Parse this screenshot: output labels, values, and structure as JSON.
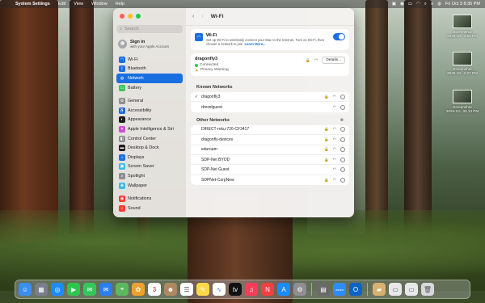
{
  "menubar": {
    "apple": "",
    "items": [
      "System Settings",
      "Edit",
      "View",
      "Window",
      "Help"
    ],
    "clock": "Fri Oct 3  8:35 PM"
  },
  "desktop_files": [
    {
      "name": "Screenshot",
      "detail": "2025-10...1.53 PM"
    },
    {
      "name": "Screenshot",
      "detail": "2025-10...2.27 PM"
    },
    {
      "name": "Screenshot",
      "detail": "2025-10...33.13 PM"
    }
  ],
  "sidebar": {
    "search_placeholder": "Search",
    "signin_title": "Sign in",
    "signin_subtitle": "with your Apple Account",
    "group1": [
      {
        "label": "Wi-Fi",
        "color": "#1a6fe0",
        "glyph": "◠"
      },
      {
        "label": "Bluetooth",
        "color": "#1a6fe0",
        "glyph": "ᛒ"
      },
      {
        "label": "Network",
        "color": "#1a6fe0",
        "glyph": "◍",
        "selected": true
      },
      {
        "label": "Battery",
        "color": "#34c759",
        "glyph": "▭"
      }
    ],
    "group2": [
      {
        "label": "General",
        "color": "#8e8e93",
        "glyph": "⚙"
      },
      {
        "label": "Accessibility",
        "color": "#1a6fe0",
        "glyph": "♿"
      },
      {
        "label": "Appearance",
        "color": "#1d1d1f",
        "glyph": "◐"
      },
      {
        "label": "Apple Intelligence & Siri",
        "color": "#d04ad6",
        "glyph": "✦"
      },
      {
        "label": "Control Center",
        "color": "#8e8e93",
        "glyph": "◧"
      },
      {
        "label": "Desktop & Dock",
        "color": "#1d1d1f",
        "glyph": "▬"
      },
      {
        "label": "Displays",
        "color": "#1a6fe0",
        "glyph": "☼"
      },
      {
        "label": "Screen Saver",
        "color": "#3fb8e8",
        "glyph": "▣"
      },
      {
        "label": "Spotlight",
        "color": "#8e8e93",
        "glyph": "⌕"
      },
      {
        "label": "Wallpaper",
        "color": "#3fb8e8",
        "glyph": "❀"
      }
    ],
    "group3": [
      {
        "label": "Notifications",
        "color": "#ff3b30",
        "glyph": "◉"
      },
      {
        "label": "Sound",
        "color": "#ff3b30",
        "glyph": "♪"
      }
    ]
  },
  "main": {
    "title": "Wi-Fi",
    "wifi": {
      "title": "Wi-Fi",
      "desc": "Set up Wi-Fi to wirelessly connect your Mac to the Internet. Turn on Wi-Fi, then choose a network to join.",
      "link": "Learn More..."
    },
    "connected": {
      "name": "dragonfly3",
      "status": "Connected",
      "warning": "Privacy Warning",
      "details_label": "Details..."
    },
    "known_title": "Known Networks",
    "known": [
      {
        "name": "dragonfly3",
        "checked": true,
        "lock": true
      },
      {
        "name": "drexelguest",
        "checked": false,
        "lock": false
      }
    ],
    "other_title": "Other Networks",
    "other": [
      {
        "name": "DIRECT-roku-726-CF3417",
        "lock": true
      },
      {
        "name": "dragonfly-devices",
        "lock": true
      },
      {
        "name": "eduroam",
        "lock": true
      },
      {
        "name": "SDP-Net BYOD",
        "lock": true
      },
      {
        "name": "SDP-Net Guest",
        "lock": false
      },
      {
        "name": "SDPNet-CorpNew",
        "lock": true
      }
    ]
  },
  "dock": [
    {
      "name": "finder",
      "color": "#3a8ef0",
      "glyph": "☺"
    },
    {
      "name": "launchpad",
      "color": "#7a7d8c",
      "glyph": "▦"
    },
    {
      "name": "safari",
      "color": "#1a8cff",
      "glyph": "◎"
    },
    {
      "name": "facetime",
      "color": "#2fc650",
      "glyph": "▶"
    },
    {
      "name": "messages",
      "color": "#34c759",
      "glyph": "✉"
    },
    {
      "name": "mail",
      "color": "#2a7ef0",
      "glyph": "✉"
    },
    {
      "name": "maps",
      "color": "#5cb85c",
      "glyph": "⌖"
    },
    {
      "name": "photos",
      "color": "#f0a030",
      "glyph": "✿"
    },
    {
      "name": "calendar",
      "color": "#ffffff",
      "glyph": "3",
      "text_color": "#e03030"
    },
    {
      "name": "contacts",
      "color": "#b08860",
      "glyph": "☻"
    },
    {
      "name": "reminders",
      "color": "#ffffff",
      "glyph": "☰",
      "text_color": "#555"
    },
    {
      "name": "notes",
      "color": "#ffd84a",
      "glyph": "✎"
    },
    {
      "name": "freeform",
      "color": "#ffffff",
      "glyph": "∿",
      "text_color": "#3a8ef0"
    },
    {
      "name": "tv",
      "color": "#111111",
      "glyph": "tv"
    },
    {
      "name": "music",
      "color": "#fa3c5a",
      "glyph": "♫"
    },
    {
      "name": "news",
      "color": "#f24040",
      "glyph": "N"
    },
    {
      "name": "app-store",
      "color": "#1a8cff",
      "glyph": "A"
    },
    {
      "name": "system-settings",
      "color": "#8e8e93",
      "glyph": "⚙"
    },
    {
      "name": "preview",
      "color": "#6a6a6a",
      "glyph": "▤"
    },
    {
      "name": "zoom",
      "color": "#2d8cff",
      "glyph": "zoom"
    },
    {
      "name": "outlook",
      "color": "#0a64c8",
      "glyph": "O"
    },
    {
      "name": "archive",
      "color": "#d8b070",
      "glyph": "▰"
    },
    {
      "name": "downloads-stack",
      "color": "#e8e8ea",
      "glyph": "▭",
      "text_color": "#555"
    },
    {
      "name": "screenshot-stack",
      "color": "#e8e8ea",
      "glyph": "▭",
      "text_color": "#555"
    },
    {
      "name": "trash",
      "color": "#d8d8dc",
      "glyph": "🗑",
      "text_color": "#555"
    }
  ]
}
